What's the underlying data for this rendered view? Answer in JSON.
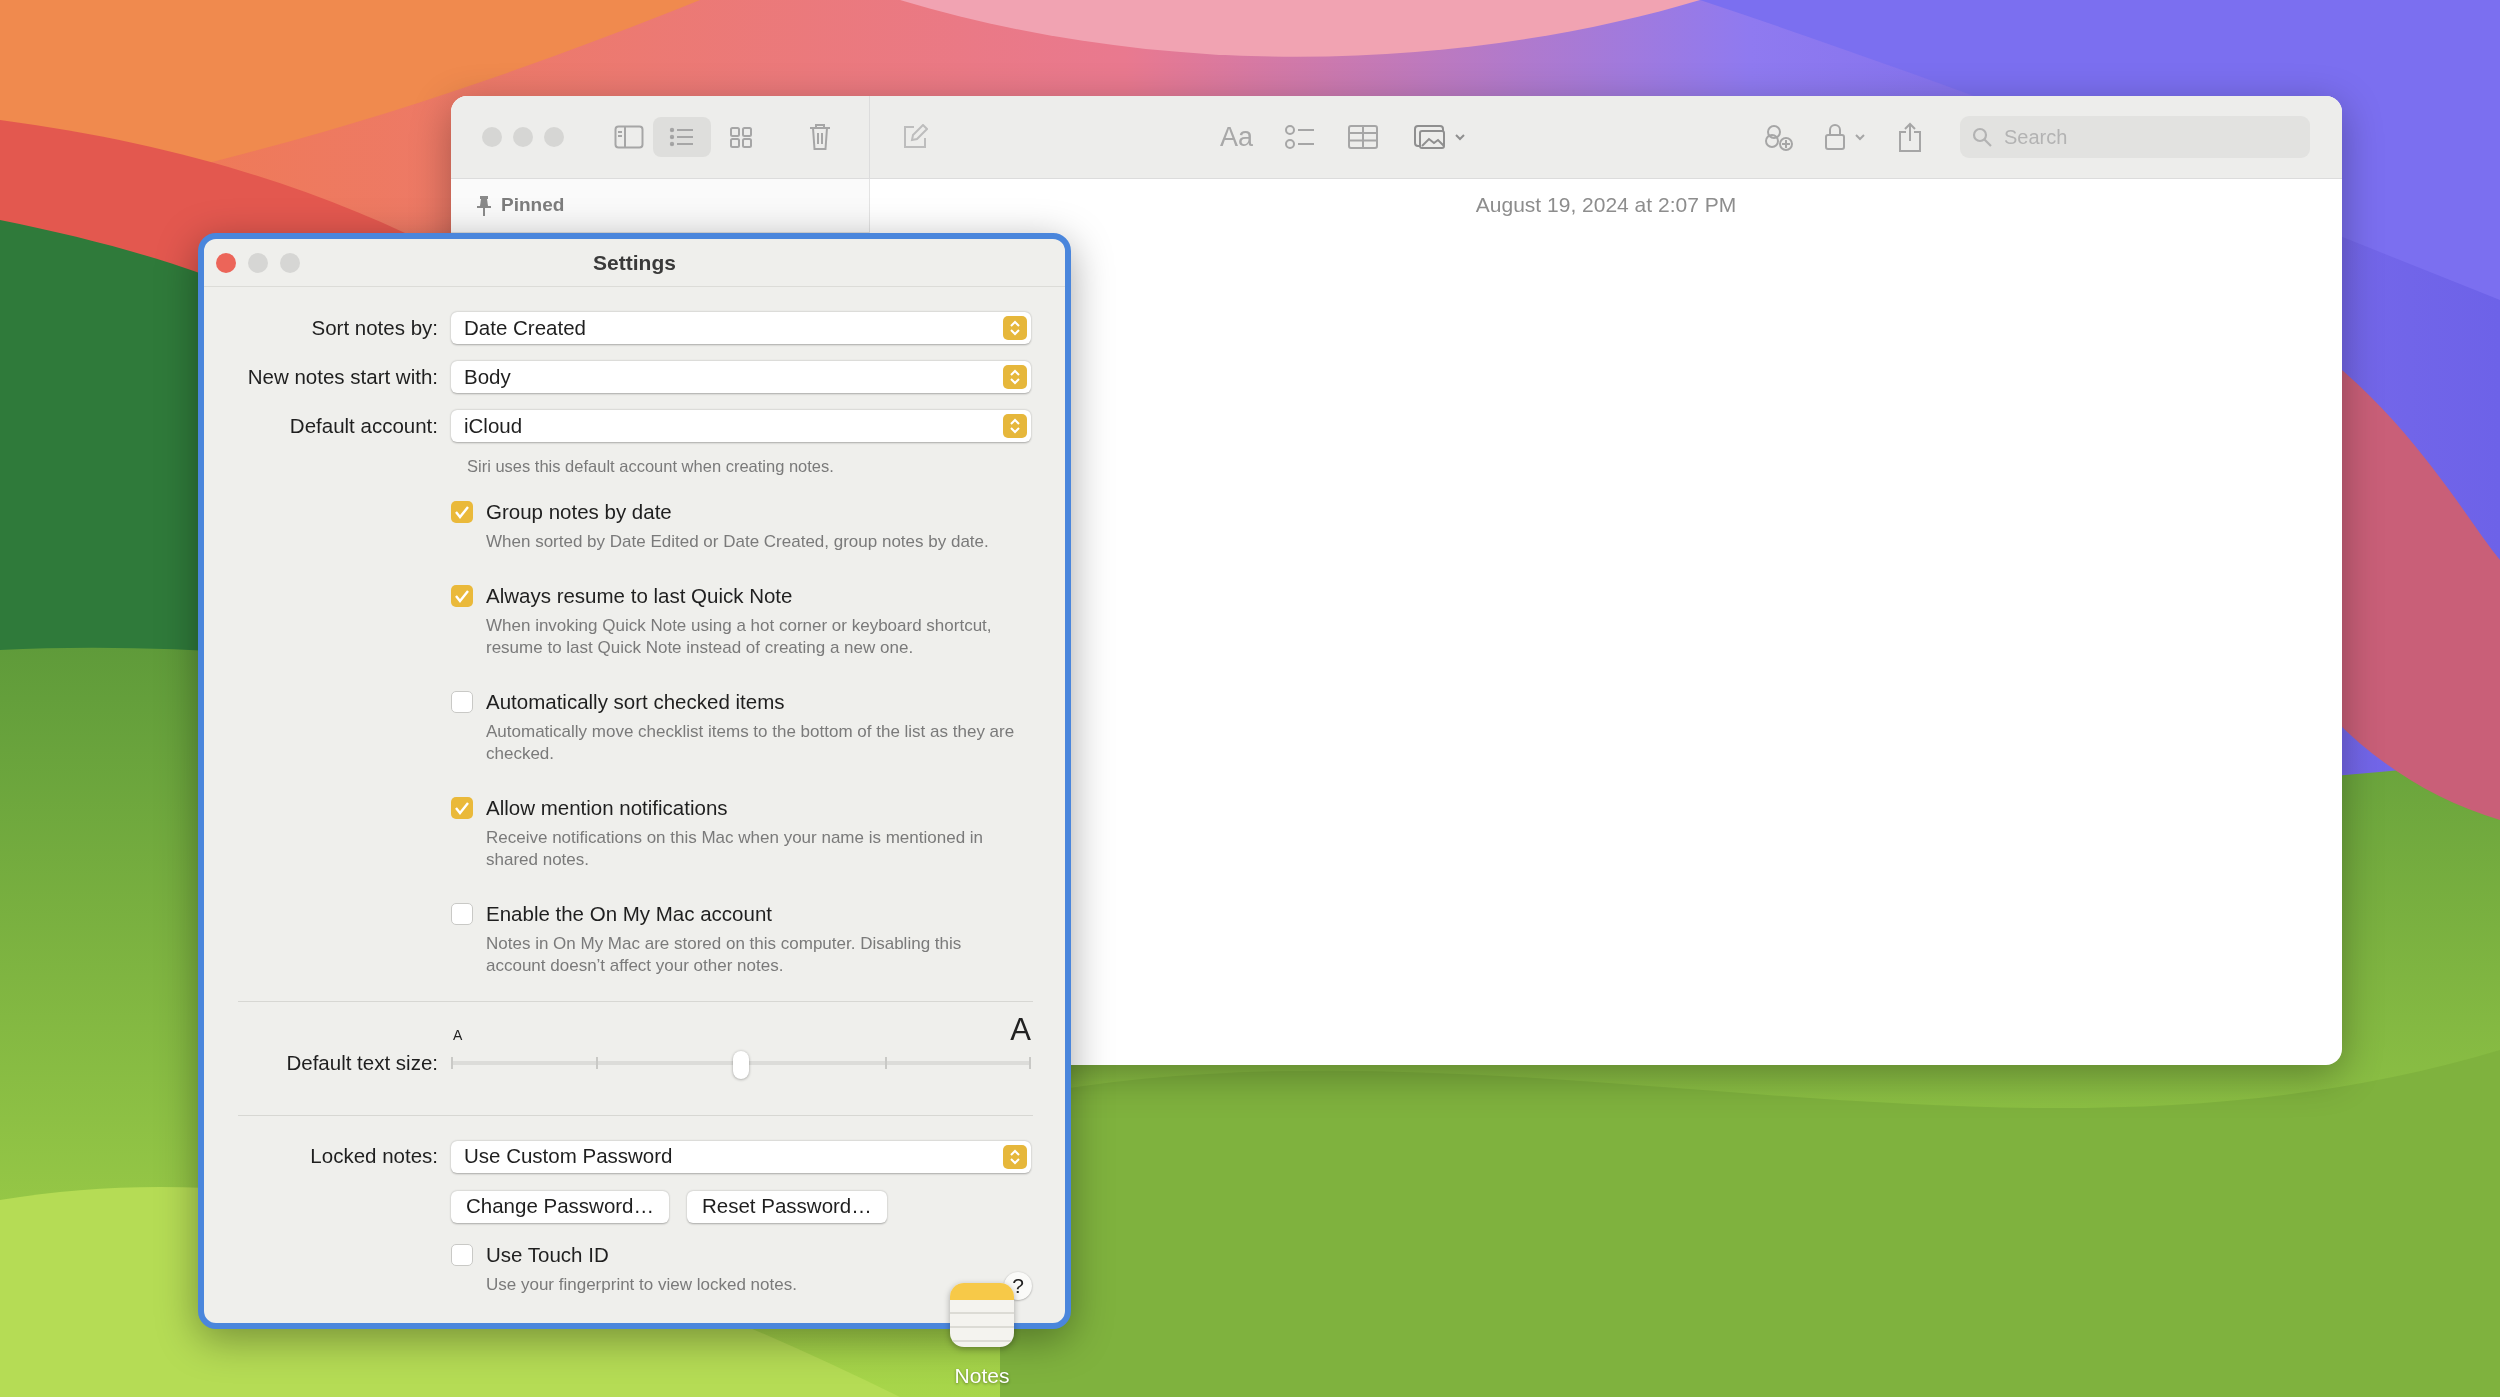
{
  "notes_window": {
    "view_buttons": [
      {
        "kind": "list",
        "selected": true
      },
      {
        "kind": "gallery",
        "selected": false
      }
    ],
    "format_button": "Aa",
    "search": {
      "placeholder": "Search"
    },
    "sidebar": {
      "section": "Pinned"
    },
    "note": {
      "date": "August 19, 2024 at 2:07 PM"
    }
  },
  "settings": {
    "title": "Settings",
    "popups": [
      {
        "label": "Sort notes by:",
        "value": "Date Created"
      },
      {
        "label": "New notes start with:",
        "value": "Body"
      },
      {
        "label": "Default account:",
        "value": "iCloud"
      }
    ],
    "account_hint": "Siri uses this default account when creating notes.",
    "options": [
      {
        "label": "Group notes by date",
        "description": "When sorted by Date Edited or Date Created, group notes by date.",
        "checked": true
      },
      {
        "label": "Always resume to last Quick Note",
        "description": "When invoking Quick Note using a hot corner or keyboard shortcut, resume to last Quick Note instead of creating a new one.",
        "checked": true
      },
      {
        "label": "Automatically sort checked items",
        "description": "Automatically move checklist items to the bottom of the list as they are checked.",
        "checked": false
      },
      {
        "label": "Allow mention notifications",
        "description": "Receive notifications on this Mac when your name is mentioned in shared notes.",
        "checked": true
      },
      {
        "label": "Enable the On My Mac account",
        "description": "Notes in On My Mac are stored on this computer. Disabling this account doesn’t affect your other notes.",
        "checked": false
      }
    ],
    "text_size": {
      "label": "Default text size:",
      "small_glyph": "A",
      "large_glyph": "A",
      "level": 0.5
    },
    "locked_notes": {
      "label": "Locked notes:",
      "value": "Use Custom Password"
    },
    "buttons": [
      "Change Password…",
      "Reset Password…"
    ],
    "touch_id": {
      "label": "Use Touch ID",
      "description": "Use your fingerprint to view locked notes.",
      "checked": false
    },
    "help": "?"
  },
  "dock": {
    "app_label": "Notes"
  }
}
